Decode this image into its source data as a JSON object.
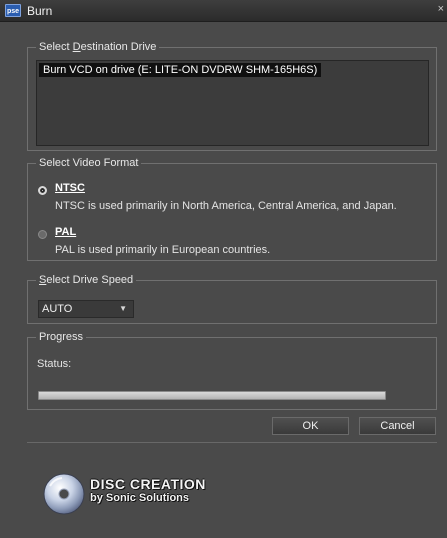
{
  "window": {
    "title": "Burn",
    "app_icon_text": "pse",
    "close_glyph": "×"
  },
  "destination": {
    "legend_prefix": "Select ",
    "legend_underlined": "D",
    "legend_suffix": "estination Drive",
    "drives": [
      "Burn VCD on drive (E: LITE-ON  DVDRW SHM-165H6S)"
    ],
    "selected_index": 0
  },
  "video_format": {
    "legend": "Select Video Format",
    "options": [
      {
        "label": "NTSC",
        "description": "NTSC is used primarily in North America, Central America, and Japan.",
        "selected": true
      },
      {
        "label": "PAL",
        "description": "PAL is used primarily in European countries.",
        "selected": false
      }
    ]
  },
  "drive_speed": {
    "legend_underlined": "S",
    "legend_suffix": "elect Drive Speed",
    "value": "AUTO"
  },
  "progress": {
    "legend": "Progress",
    "status_label": "Status:",
    "value": 0
  },
  "buttons": {
    "ok": "OK",
    "cancel": "Cancel"
  },
  "logo": {
    "line1": "DISC CREATION",
    "line2": "by Sonic Solutions"
  },
  "colors": {
    "background": "#4a4a4a",
    "titlebar": "#2f2f2f",
    "selection": "#101010"
  }
}
